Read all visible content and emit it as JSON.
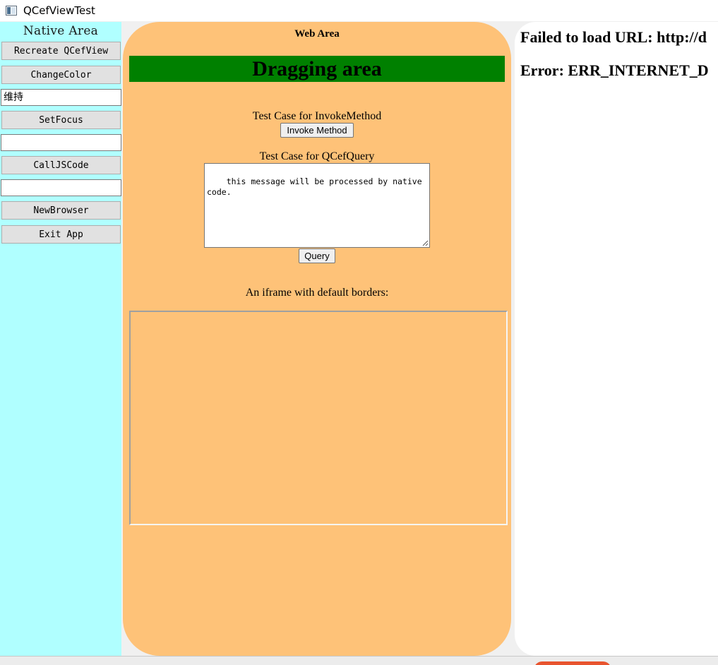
{
  "window": {
    "title": "QCefViewTest"
  },
  "native": {
    "title": "Native Area",
    "recreate_label": "Recreate QCefView",
    "change_color_label": "ChangeColor",
    "color_input_value": "维持",
    "set_focus_label": "SetFocus",
    "focus_input_value": "",
    "call_js_label": "CallJSCode",
    "js_input_value": "",
    "new_browser_label": "NewBrowser",
    "exit_label": "Exit App"
  },
  "web": {
    "title": "Web Area",
    "dragging_label": "Dragging area",
    "invoke_caption": "Test Case for InvokeMethod",
    "invoke_button": "Invoke Method",
    "query_caption": "Test Case for QCefQuery",
    "query_text": "this message will be processed by native code.",
    "query_button": "Query",
    "iframe_caption": "An iframe with default borders:"
  },
  "error_page": {
    "line1": "Failed to load URL: http://d",
    "line2": "Error: ERR_INTERNET_D"
  },
  "colors": {
    "native_bg": "#b0ffff",
    "web_bg": "#fec278",
    "drag_bg": "#008000"
  }
}
